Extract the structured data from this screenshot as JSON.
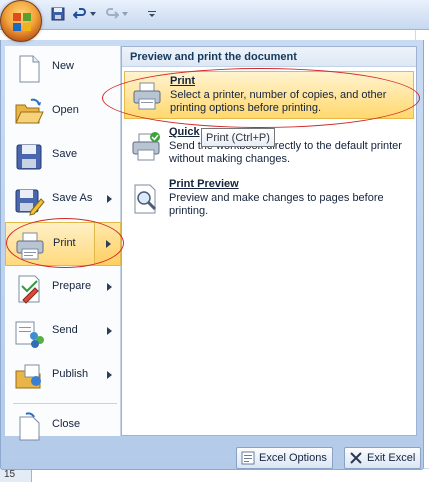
{
  "quick_access": {
    "save": "save-icon",
    "undo": "undo-icon",
    "redo": "redo-icon",
    "customize": "customize-icon"
  },
  "left_menu": {
    "items": [
      {
        "label": "New",
        "icon": "new-document-icon"
      },
      {
        "label": "Open",
        "icon": "open-folder-icon"
      },
      {
        "label": "Save",
        "icon": "save-disk-icon"
      },
      {
        "label": "Save As",
        "icon": "save-as-icon"
      },
      {
        "label": "Print",
        "icon": "printer-icon"
      },
      {
        "label": "Prepare",
        "icon": "prepare-icon"
      },
      {
        "label": "Send",
        "icon": "send-icon"
      },
      {
        "label": "Publish",
        "icon": "publish-icon"
      },
      {
        "label": "Close",
        "icon": "close-folder-icon"
      }
    ]
  },
  "submenu": {
    "header": "Preview and print the document",
    "items": [
      {
        "title": "Print",
        "description": "Select a printer, number of copies, and other printing options before printing."
      },
      {
        "title": "Quick",
        "description": "Send the workbook directly to the default printer without making changes."
      },
      {
        "title": "Print Preview",
        "description": "Preview and make changes to pages before printing."
      }
    ],
    "tooltip": "Print (Ctrl+P)"
  },
  "footer": {
    "options_label": "Excel Options",
    "exit_label": "Exit Excel"
  },
  "sheet": {
    "row_number": "15"
  },
  "colors": {
    "highlight": "#ffd97d",
    "annotation": "#d22a2a",
    "menu_bg": "#c9dbf2"
  }
}
